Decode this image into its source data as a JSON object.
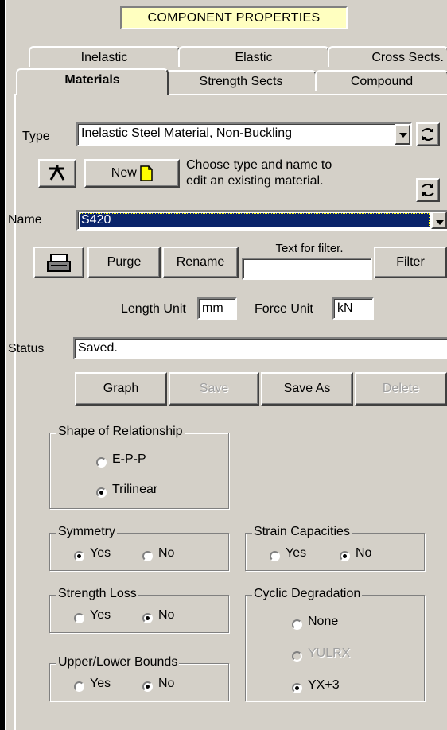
{
  "title": "COMPONENT PROPERTIES",
  "tabs_back": [
    "Inelastic",
    "Elastic",
    "Cross Sects."
  ],
  "tabs_front": [
    "Materials",
    "Strength Sects",
    "Compound"
  ],
  "type": {
    "label": "Type",
    "value": "Inelastic Steel Material, Non-Buckling"
  },
  "new_button": "New",
  "hint_line1": "Choose type and name to",
  "hint_line2": "edit an existing material.",
  "name": {
    "label": "Name",
    "value": "S420"
  },
  "buttons": {
    "purge": "Purge",
    "rename": "Rename",
    "filter": "Filter",
    "graph": "Graph",
    "save": "Save",
    "save_as": "Save As",
    "delete": "Delete"
  },
  "filter": {
    "label": "Text for filter.",
    "value": ""
  },
  "length_unit": {
    "label": "Length Unit",
    "value": "mm"
  },
  "force_unit": {
    "label": "Force Unit",
    "value": "kN"
  },
  "status": {
    "label": "Status",
    "value": "Saved."
  },
  "shape": {
    "title": "Shape of Relationship",
    "options": [
      "E-P-P",
      "Trilinear"
    ],
    "selected": "Trilinear"
  },
  "symmetry": {
    "title": "Symmetry",
    "options": [
      "Yes",
      "No"
    ],
    "selected": "Yes"
  },
  "strain": {
    "title": "Strain Capacities",
    "options": [
      "Yes",
      "No"
    ],
    "selected": "No"
  },
  "strength_loss": {
    "title": "Strength Loss",
    "options": [
      "Yes",
      "No"
    ],
    "selected": "No"
  },
  "cyclic": {
    "title": "Cyclic Degradation",
    "options": [
      "None",
      "YULRX",
      "YX+3"
    ],
    "selected": "YX+3",
    "disabled": "YULRX"
  },
  "bounds": {
    "title": "Upper/Lower Bounds",
    "options": [
      "Yes",
      "No"
    ],
    "selected": "No"
  },
  "colors": {
    "panel": "#d4d0c8",
    "title_bg": "#ffffc0",
    "selection": "#0a246a",
    "new_icon": "#ffff00"
  }
}
